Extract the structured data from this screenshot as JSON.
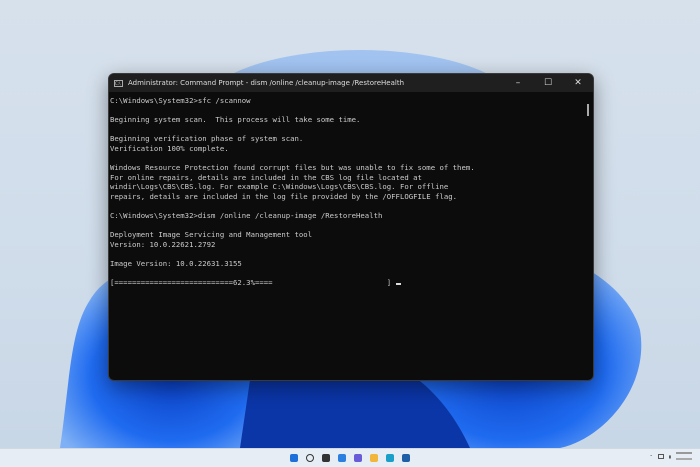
{
  "window": {
    "title": "Administrator: Command Prompt - dism  /online /cleanup-image /RestoreHealth",
    "icon": "terminal-icon",
    "controls": [
      "minimize",
      "maximize",
      "close"
    ]
  },
  "terminal": {
    "lines": [
      "C:\\Windows\\System32>sfc /scannow",
      "",
      "Beginning system scan.  This process will take some time.",
      "",
      "Beginning verification phase of system scan.",
      "Verification 100% complete.",
      "",
      "Windows Resource Protection found corrupt files but was unable to fix some of them.",
      "For online repairs, details are included in the CBS log file located at",
      "windir\\Logs\\CBS\\CBS.log. For example C:\\Windows\\Logs\\CBS\\CBS.log. For offline",
      "repairs, details are included in the log file provided by the /OFFLOGFILE flag.",
      "",
      "C:\\Windows\\System32>dism /online /cleanup-image /RestoreHealth",
      "",
      "Deployment Image Servicing and Management tool",
      "Version: 10.0.22621.2792",
      "",
      "Image Version: 10.0.22631.3155",
      ""
    ],
    "progress_line": "[===========================62.3%====                          ]",
    "progress_percent": 62.3
  },
  "taskbar": {
    "icons": [
      "start-icon",
      "search-icon",
      "task-view-icon",
      "widgets-icon",
      "chat-icon",
      "file-explorer-icon",
      "edge-icon",
      "store-icon"
    ],
    "colors": [
      "#1e6fd9",
      "#333333",
      "#333333",
      "#2a7fe0",
      "#6a5cd8",
      "#f2b73a",
      "#1aa0c8",
      "#1f5fa8"
    ]
  }
}
